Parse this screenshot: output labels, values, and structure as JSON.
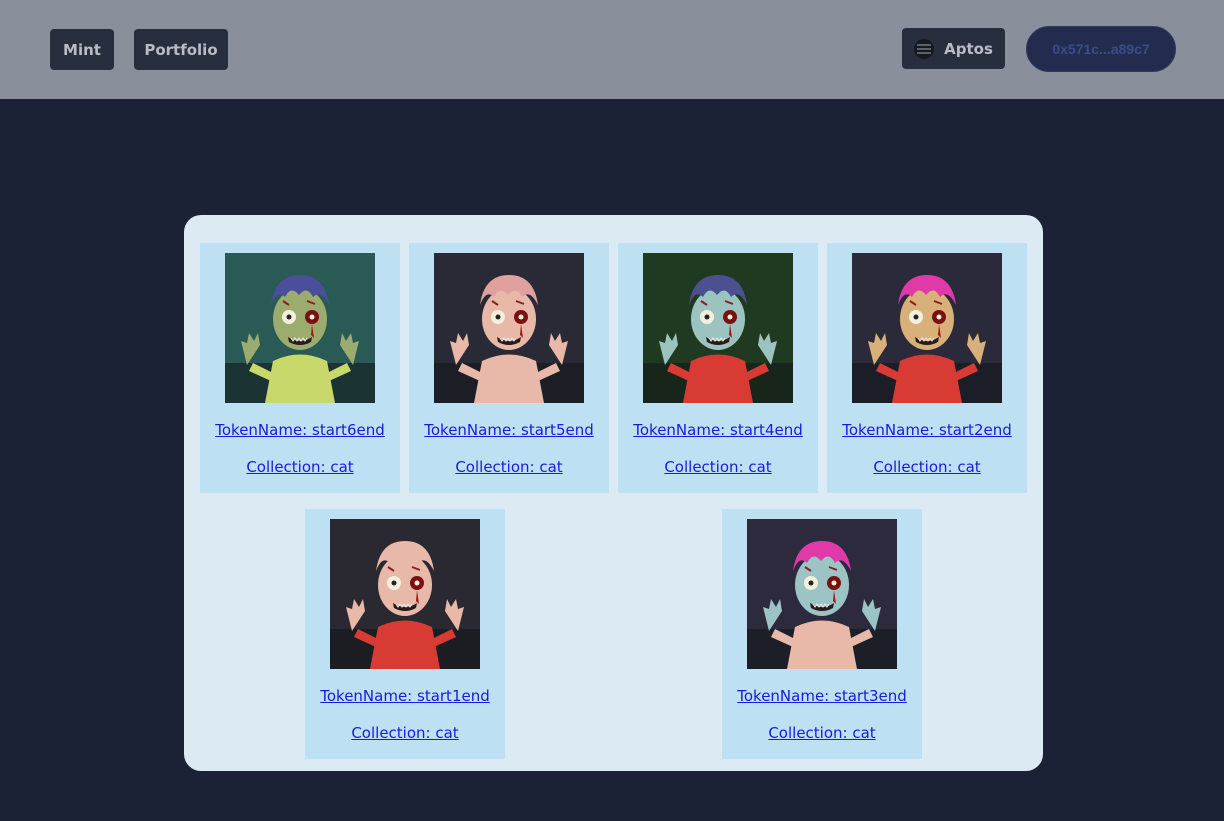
{
  "nav": {
    "mint_label": "Mint",
    "portfolio_label": "Portfolio"
  },
  "network": {
    "label": "Aptos"
  },
  "wallet": {
    "address": "0x571c...a89c7"
  },
  "tokens": [
    {
      "name": "TokenName: start6end",
      "collection": "Collection: cat",
      "hair": "#4b4e9a",
      "skin": "#9cab6e",
      "shirt": "#c9d86a",
      "bg": "#2a5a55"
    },
    {
      "name": "TokenName: start5end",
      "collection": "Collection: cat",
      "hair": "#e0a0a0",
      "skin": "#e8b8a8",
      "shirt": "#e8b8a8",
      "bg": "#2a2a36"
    },
    {
      "name": "TokenName: start4end",
      "collection": "Collection: cat",
      "hair": "#4a5090",
      "skin": "#9bc4c0",
      "shirt": "#d83a34",
      "bg": "#1f3a20"
    },
    {
      "name": "TokenName: start2end",
      "collection": "Collection: cat",
      "hair": "#e03aa8",
      "skin": "#d8b07a",
      "shirt": "#d83a34",
      "bg": "#2a2a3a"
    },
    {
      "name": "TokenName: start1end",
      "collection": "Collection: cat",
      "hair": "#e8b8a8",
      "skin": "#e8b8a8",
      "shirt": "#d83a34",
      "bg": "#2a2830"
    },
    {
      "name": "TokenName: start3end",
      "collection": "Collection: cat",
      "hair": "#e03aa8",
      "skin": "#9cc4c4",
      "shirt": "#e8b8a8",
      "bg": "#2c2a3c"
    }
  ]
}
